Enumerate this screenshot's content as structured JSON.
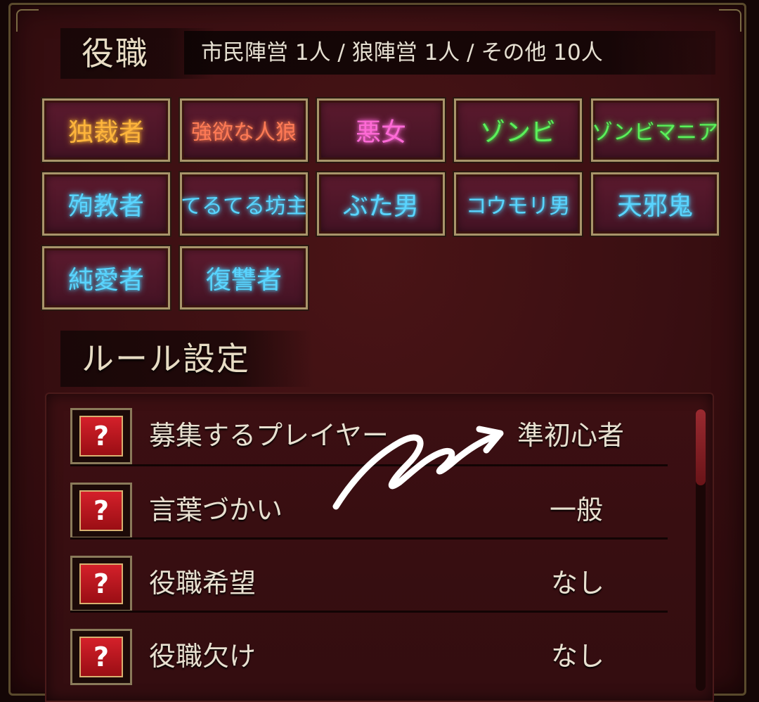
{
  "roles_section": {
    "title": "役職",
    "summary": "市民陣営 1人 / 狼陣営 1人 / その他 10人"
  },
  "roles": [
    {
      "label": "独裁者",
      "color": "#ffb43c"
    },
    {
      "label": "強欲な人狼",
      "color": "#ff7a56"
    },
    {
      "label": "悪女",
      "color": "#ff6ad6"
    },
    {
      "label": "ゾンビ",
      "color": "#5cf05a"
    },
    {
      "label": "ゾンビマニア",
      "color": "#5cf05a"
    },
    {
      "label": "殉教者",
      "color": "#5ad4ff"
    },
    {
      "label": "てるてる坊主",
      "color": "#5ad4ff"
    },
    {
      "label": "ぶた男",
      "color": "#5ad4ff"
    },
    {
      "label": "コウモリ男",
      "color": "#5ad4ff"
    },
    {
      "label": "天邪鬼",
      "color": "#5ad4ff"
    },
    {
      "label": "純愛者",
      "color": "#5ad4ff"
    },
    {
      "label": "復讐者",
      "color": "#5ad4ff"
    }
  ],
  "rules_section": {
    "title": "ルール設定",
    "rows": [
      {
        "help": "?",
        "name": "募集するプレイヤー",
        "value": "準初心者"
      },
      {
        "help": "?",
        "name": "言葉づかい",
        "value": "一般"
      },
      {
        "help": "?",
        "name": "役職希望",
        "value": "なし"
      },
      {
        "help": "?",
        "name": "役職欠け",
        "value": "なし"
      }
    ]
  }
}
